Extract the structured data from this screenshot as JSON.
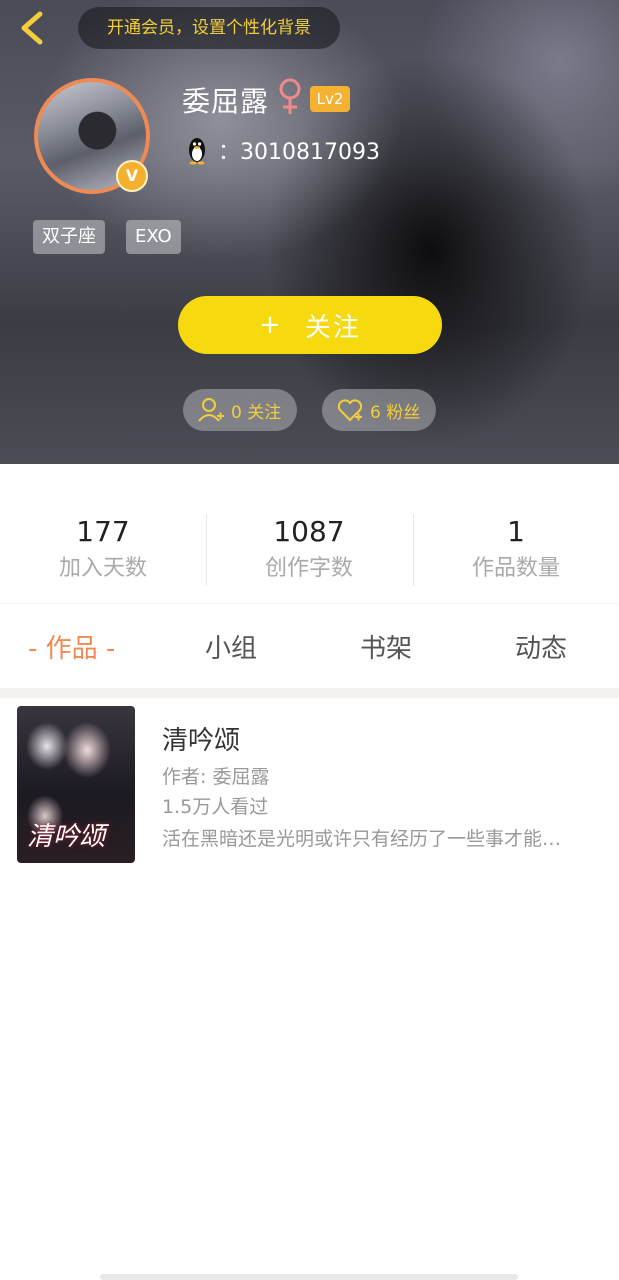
{
  "header": {
    "vip_banner": "开通会员，设置个性化背景",
    "back_icon": "chevron-left-icon"
  },
  "profile": {
    "name": "委屈露",
    "gender_icon": "female-icon",
    "level": "Lv2",
    "qq_icon": "penguin-icon",
    "qq": "：3010817093",
    "verified_badge": "V",
    "tags": [
      "双子座",
      "EXO"
    ]
  },
  "follow_button": {
    "plus": "+",
    "label": "关注"
  },
  "social": {
    "following": "0 关注",
    "fans": "6 粉丝"
  },
  "stats": [
    {
      "value": "177",
      "label": "加入天数"
    },
    {
      "value": "1087",
      "label": "创作字数"
    },
    {
      "value": "1",
      "label": "作品数量"
    }
  ],
  "tabs": [
    {
      "label": "- 作品 -",
      "active": true
    },
    {
      "label": "小组",
      "active": false
    },
    {
      "label": "书架",
      "active": false
    },
    {
      "label": "动态",
      "active": false
    }
  ],
  "works": [
    {
      "title": "清吟颂",
      "cover_title": "清吟颂",
      "author": "作者: 委屈露",
      "views": "1.5万人看过",
      "description": "活在黑暗还是光明或许只有经历了一些事才能…"
    }
  ],
  "colors": {
    "accent": "#f08a54",
    "follow_button": "#f7d90f",
    "gold_text": "#f2cf3a",
    "level_badge": "#f4b233"
  }
}
